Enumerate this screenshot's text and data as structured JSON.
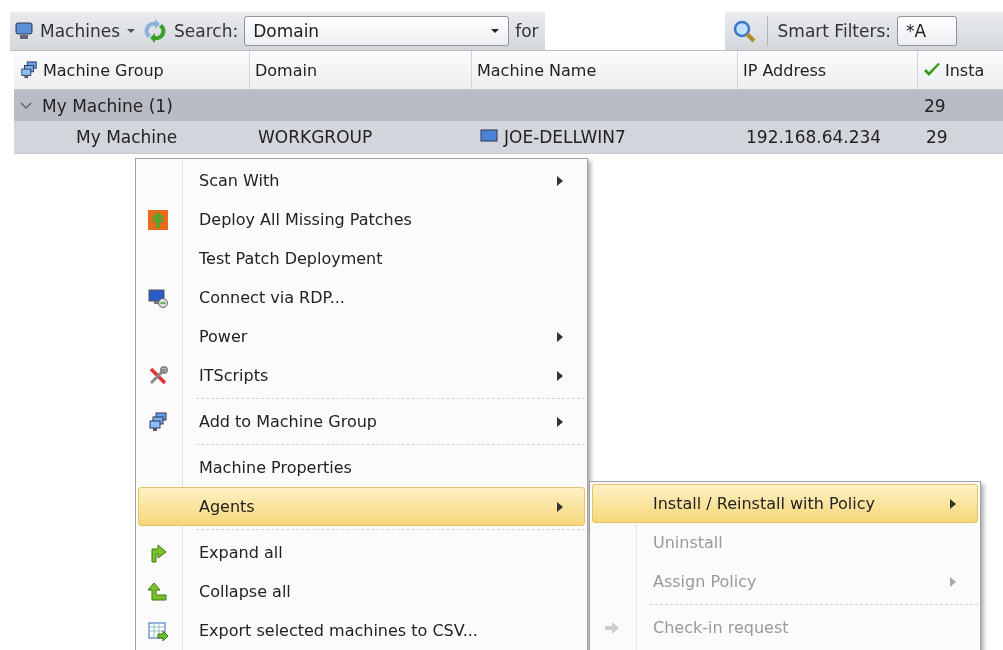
{
  "toolbar": {
    "machines_label": "Machines",
    "search_label": "Search:",
    "search_by": {
      "value": "Domain"
    },
    "for_label": "for",
    "smart_filters_label": "Smart Filters:",
    "smart_filter": {
      "value": "*A"
    }
  },
  "table": {
    "columns": [
      "Machine Group",
      "Domain",
      "Machine Name",
      "IP Address",
      "Insta"
    ],
    "groups": [
      {
        "label": "My Machine (1)",
        "expanded": true,
        "count": "29",
        "rows": [
          {
            "selected": true,
            "cells": [
              "My Machine",
              "WORKGROUP",
              "JOE-DELLWIN7",
              "192.168.64.234",
              "29"
            ]
          }
        ]
      }
    ]
  },
  "context_menu": {
    "items": [
      {
        "kind": "item",
        "label": "Scan With",
        "submenu": true,
        "selected": false,
        "disabled": false
      },
      {
        "kind": "item",
        "label": "Deploy All Missing Patches",
        "submenu": false,
        "selected": false,
        "disabled": false
      },
      {
        "kind": "item",
        "label": "Test Patch Deployment",
        "submenu": false,
        "selected": false,
        "disabled": false
      },
      {
        "kind": "item",
        "label": "Connect via RDP...",
        "submenu": false,
        "selected": false,
        "disabled": false
      },
      {
        "kind": "item",
        "label": "Power",
        "submenu": true,
        "selected": false,
        "disabled": false
      },
      {
        "kind": "item",
        "label": "ITScripts",
        "submenu": true,
        "selected": false,
        "disabled": false
      },
      {
        "kind": "separator"
      },
      {
        "kind": "item",
        "label": "Add to Machine Group",
        "submenu": true,
        "selected": false,
        "disabled": false
      },
      {
        "kind": "separator"
      },
      {
        "kind": "item",
        "label": "Machine Properties",
        "submenu": false,
        "selected": false,
        "disabled": false
      },
      {
        "kind": "item",
        "label": "Agents",
        "submenu": true,
        "selected": true,
        "disabled": false
      },
      {
        "kind": "separator"
      },
      {
        "kind": "item",
        "label": "Expand all",
        "submenu": false,
        "selected": false,
        "disabled": false
      },
      {
        "kind": "item",
        "label": "Collapse all",
        "submenu": false,
        "selected": false,
        "disabled": false
      },
      {
        "kind": "item",
        "label": "Export selected machines to CSV...",
        "submenu": false,
        "selected": false,
        "disabled": false
      }
    ]
  },
  "agents_submenu": {
    "items": [
      {
        "kind": "item",
        "label": "Install / Reinstall with Policy",
        "submenu": true,
        "selected": true,
        "disabled": false
      },
      {
        "kind": "item",
        "label": "Uninstall",
        "submenu": false,
        "selected": false,
        "disabled": true
      },
      {
        "kind": "item",
        "label": "Assign Policy",
        "submenu": true,
        "selected": false,
        "disabled": true
      },
      {
        "kind": "separator"
      },
      {
        "kind": "item",
        "label": "Check-in request",
        "submenu": false,
        "selected": false,
        "disabled": true
      }
    ]
  }
}
